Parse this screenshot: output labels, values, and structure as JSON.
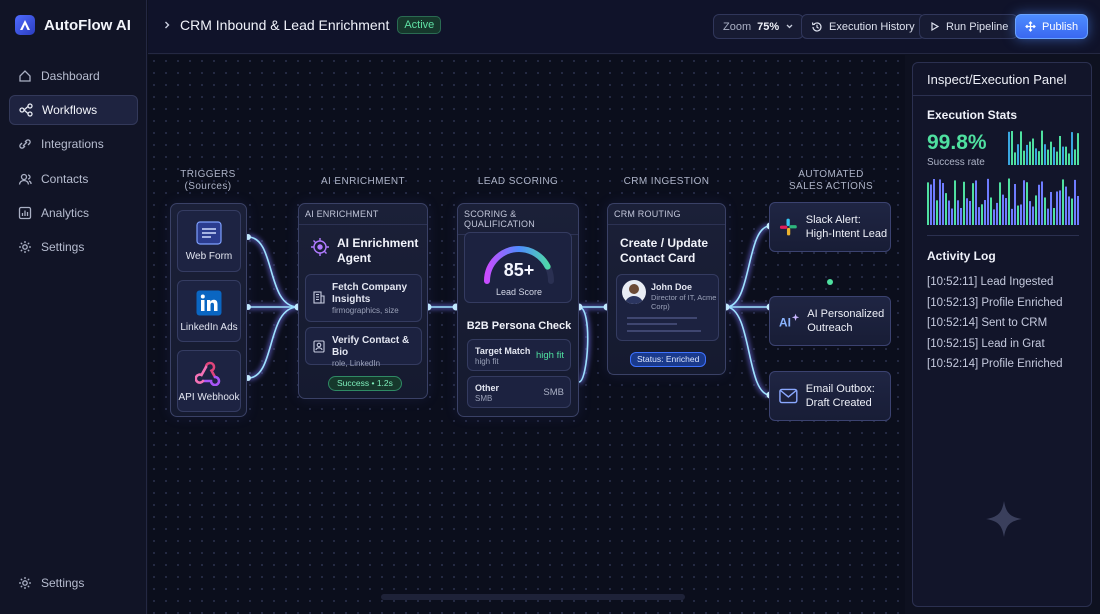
{
  "app": {
    "name": "AutoFlow AI"
  },
  "sidebar": {
    "items": [
      {
        "label": "Dashboard",
        "icon": "dashboard-icon"
      },
      {
        "label": "Workflows",
        "icon": "workflow-icon",
        "active": true
      },
      {
        "label": "Integrations",
        "icon": "integrations-icon"
      },
      {
        "label": "Contacts",
        "icon": "contacts-icon"
      },
      {
        "label": "Analytics",
        "icon": "analytics-icon"
      },
      {
        "label": "Settings",
        "icon": "gear-icon"
      }
    ],
    "bottom_label": "Settings"
  },
  "header": {
    "title": "CRM Inbound & Lead Enrichment",
    "status": "Active",
    "zoom_label": "Zoom",
    "zoom_value": "75%",
    "history_label": "Execution History",
    "run_label": "Run Pipeline",
    "publish_label": "Publish"
  },
  "canvas": {
    "columns": {
      "triggers": "TRIGGERS\n(Sources)",
      "enrichment": "AI ENRICHMENT",
      "scoring": "LEAD SCORING",
      "crm": "CRM INGESTION",
      "actions": "AUTOMATED\nSALES ACTIONS"
    },
    "triggers": [
      "Web Form",
      "LinkedIn Ads",
      "API Webhook"
    ],
    "enrichment": {
      "header": "AI ENRICHMENT",
      "title": "AI Enrichment Agent",
      "step1_title": "Fetch Company Insights",
      "step1_sub": "firmographics, size",
      "step2_title": "Verify Contact & Bio",
      "step2_sub": "role, LinkedIn",
      "status": "Success • 1.2s"
    },
    "scoring": {
      "header": "SCORING & QUALIFICATION",
      "score": "85+",
      "score_label": "Lead Score",
      "score_fraction": 0.85,
      "persona_title": "B2B Persona Check",
      "row1_title": "Target Match",
      "row1_sub": "high fit",
      "row1_value": "high fit",
      "row2_title": "Other",
      "row2_sub": "SMB",
      "row2_value": "SMB"
    },
    "crm": {
      "header": "CRM ROUTING",
      "title": "Create / Update Contact Card",
      "contact_name": "John Doe",
      "contact_role": "Director of IT, Acme Corp)",
      "status": "Status: Enriched"
    },
    "actions": [
      "Slack Alert: High-Intent Lead",
      "AI Personalized Outreach",
      "Email Outbox: Draft Created"
    ]
  },
  "panel": {
    "title": "Inspect/Execution Panel",
    "stats_heading": "Execution Stats",
    "success_rate": "99.8%",
    "success_label": "Success rate",
    "log_heading": "Activity Log",
    "log": [
      "[10:52:11] Lead Ingested",
      "[10:52:13] Profile Enriched",
      "[10:52:14] Sent to CRM",
      "[10:52:15] Lead in Grat",
      "[10:52:14]  Profile Enriched"
    ]
  },
  "colors": {
    "accent": "#4d8cff",
    "success": "#4fe0a0",
    "wire": "#8fd8ff",
    "wire_glow": "#8a7bff"
  }
}
